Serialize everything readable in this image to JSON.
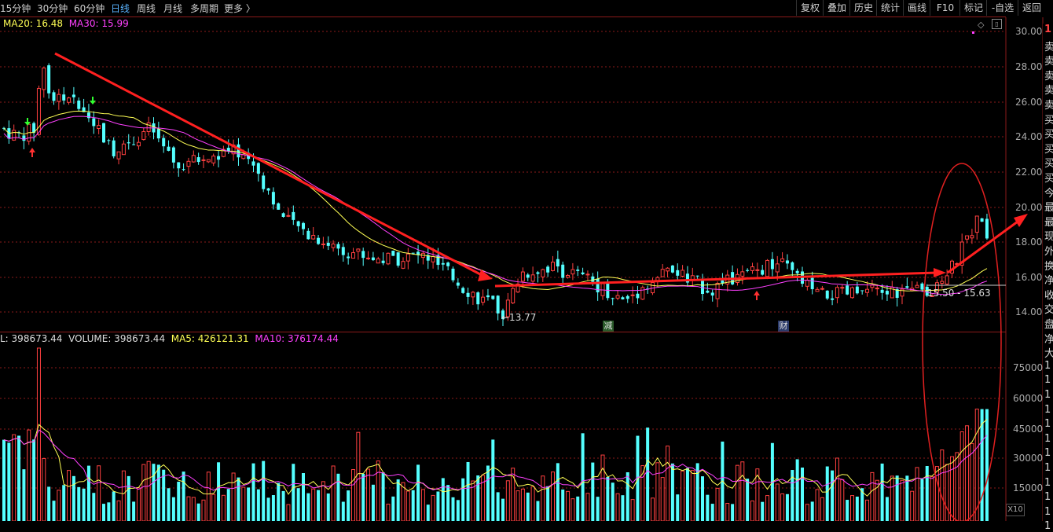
{
  "periods": [
    "15分钟",
    "30分钟",
    "60分钟",
    "日线",
    "周线",
    "月线",
    "多周期",
    "更多 〉"
  ],
  "active_period": "日线",
  "toolbar": [
    "复权",
    "叠加",
    "历史",
    "统计",
    "画线",
    "F10",
    "标记",
    "-自选",
    "返回"
  ],
  "ma_legend": {
    "ma20": "MA20: 16.48",
    "ma30": "MA30: 15.99"
  },
  "vol_legend": {
    "l": "L: 398673.44",
    "vol": "VOLUME: 398673.44",
    "ma5": "MA5: 426121.31",
    "ma10": "MA10: 376174.44"
  },
  "price_axis": [
    "30.00",
    "28.00",
    "26.00",
    "24.00",
    "22.00",
    "20.00",
    "18.00",
    "16.00",
    "14.00"
  ],
  "volume_axis": [
    "75000",
    "60000",
    "45000",
    "30000",
    "15000"
  ],
  "annotations": {
    "low": "←13.77",
    "range": "15.50 - 15.63",
    "jian": "减",
    "cai": "财"
  },
  "x10": "X10",
  "right_panel_chars": [
    "1",
    "卖",
    "卖",
    "卖",
    "卖",
    "卖",
    "买",
    "买",
    "买",
    "买",
    "买",
    "今",
    "最",
    "最",
    "现",
    "外",
    "换",
    "净",
    "收",
    "交",
    "盘",
    "净",
    "大",
    "1",
    "1",
    "1",
    "1",
    "1",
    "1",
    "1",
    "1",
    "1",
    "1",
    "1",
    "1"
  ],
  "colors": {
    "up": "#ff4040",
    "down": "#54ffff",
    "ma20": "#ffff55",
    "ma30": "#ff40ff",
    "arrow": "#ff2020"
  }
}
